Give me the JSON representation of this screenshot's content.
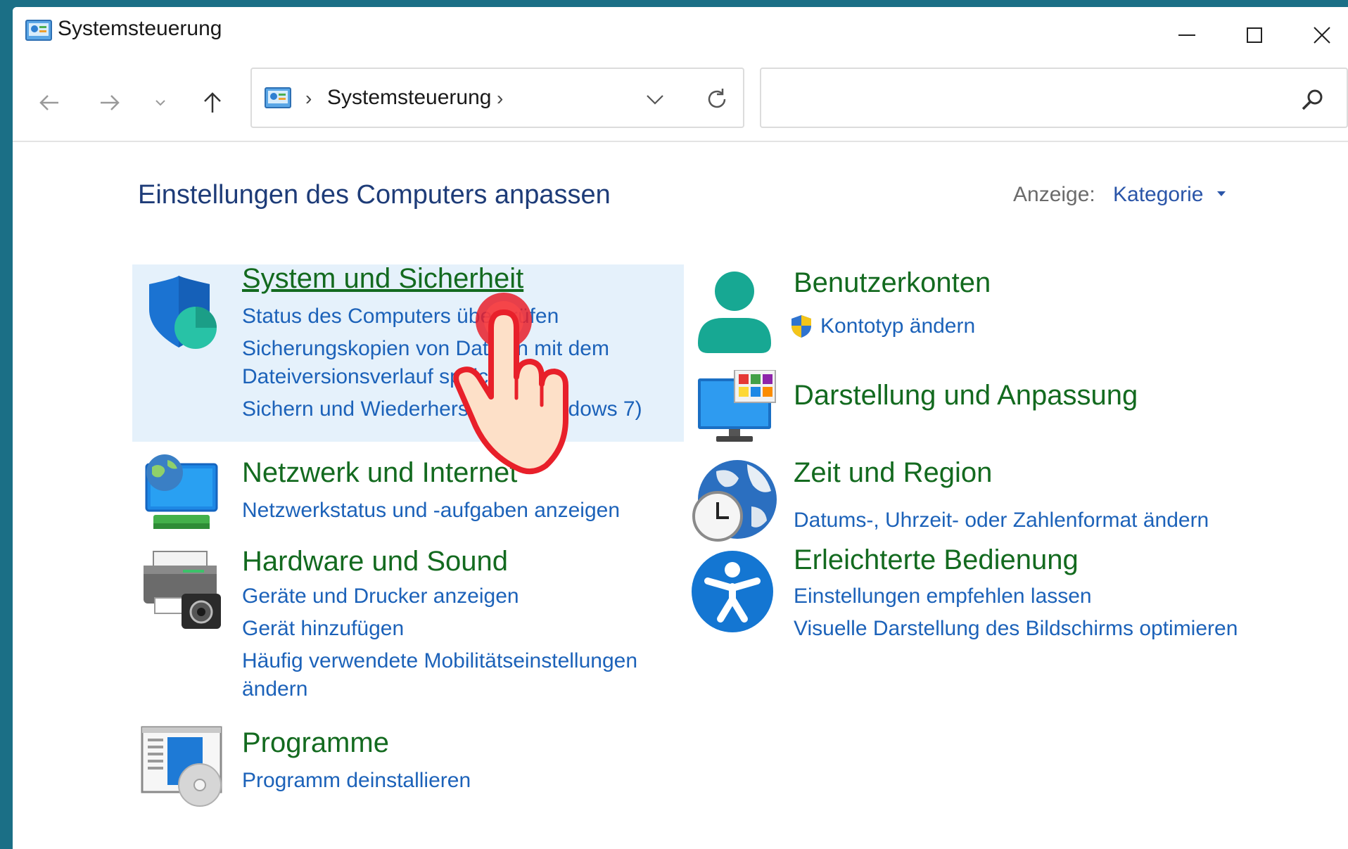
{
  "window": {
    "title": "Systemsteuerung"
  },
  "address": {
    "crumb": "Systemsteuerung",
    "separator": "›"
  },
  "search": {
    "placeholder": ""
  },
  "content": {
    "heading": "Einstellungen des Computers anpassen",
    "view_label": "Anzeige:",
    "view_value": "Kategorie"
  },
  "categories": {
    "system": {
      "title": "System und Sicherheit",
      "links": [
        "Status des Computers überprüfen",
        "Sicherungskopien von Dateien mit dem",
        "Dateiversionsverlauf speichern",
        "Sichern und Wiederherstellen (Windows 7)"
      ]
    },
    "network": {
      "title": "Netzwerk und Internet",
      "links": [
        "Netzwerkstatus und -aufgaben anzeigen"
      ]
    },
    "hardware": {
      "title": "Hardware und Sound",
      "links": [
        "Geräte und Drucker anzeigen",
        "Gerät hinzufügen",
        "Häufig verwendete Mobilitätseinstellungen",
        "ändern"
      ]
    },
    "programs": {
      "title": "Programme",
      "links": [
        "Programm deinstallieren"
      ]
    },
    "accounts": {
      "title": "Benutzerkonten",
      "links": [
        "Kontotyp ändern"
      ]
    },
    "appearance": {
      "title": "Darstellung und Anpassung",
      "links": []
    },
    "region": {
      "title": "Zeit und Region",
      "links": [
        "Datums-, Uhrzeit- oder Zahlenformat ändern"
      ]
    },
    "access": {
      "title": "Erleichterte Bedienung",
      "links": [
        "Einstellungen empfehlen lassen",
        "Visuelle Darstellung des Bildschirms optimieren"
      ]
    }
  },
  "colors": {
    "category_title": "#136a1f",
    "link": "#1c62b9",
    "heading": "#1e3c78",
    "hover_bg": "#e5f1fb",
    "pointer_red": "#e8202a"
  },
  "icons": {
    "system": "shield-icon",
    "network": "network-monitor-icon",
    "hardware": "printer-icon",
    "programs": "programs-icon",
    "accounts": "user-icon",
    "appearance": "display-icon",
    "region": "globe-clock-icon",
    "access": "accessibility-icon",
    "pointer": "hand-pointer-icon"
  }
}
